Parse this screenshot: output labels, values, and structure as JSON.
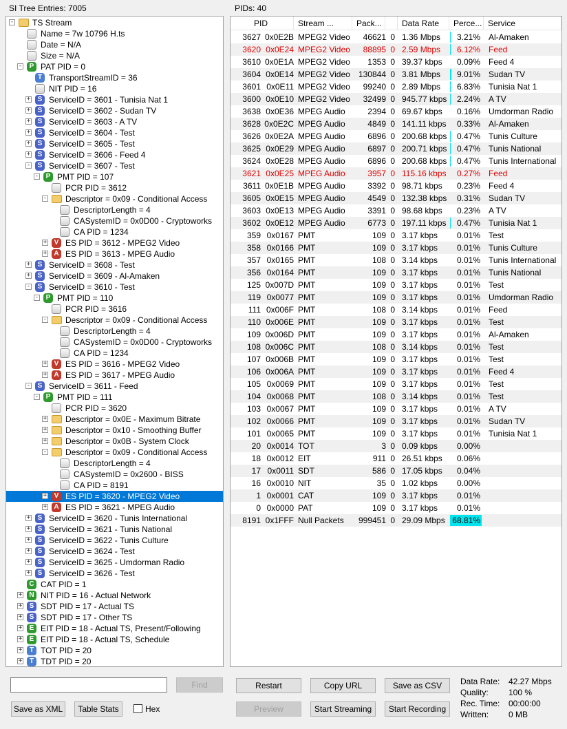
{
  "left_label": "SI Tree Entries: 7005",
  "right_label": "PIDs: 40",
  "tree": [
    {
      "d": 0,
      "e": "-",
      "i": "folder",
      "t": "TS Stream"
    },
    {
      "d": 1,
      "e": "",
      "i": "doc",
      "t": "Name = 7w 10796 H.ts"
    },
    {
      "d": 1,
      "e": "",
      "i": "doc",
      "t": "Date = N/A"
    },
    {
      "d": 1,
      "e": "",
      "i": "doc",
      "t": "Size = N/A"
    },
    {
      "d": 1,
      "e": "-",
      "i": "P",
      "t": "PAT PID = 0"
    },
    {
      "d": 2,
      "e": "",
      "i": "T",
      "t": "TransportStreamID = 36"
    },
    {
      "d": 2,
      "e": "",
      "i": "doc",
      "t": "NIT PID = 16"
    },
    {
      "d": 2,
      "e": "+",
      "i": "S",
      "t": "ServiceID = 3601 - Tunisia Nat 1"
    },
    {
      "d": 2,
      "e": "+",
      "i": "S",
      "t": "ServiceID = 3602 - Sudan TV"
    },
    {
      "d": 2,
      "e": "+",
      "i": "S",
      "t": "ServiceID = 3603 - A TV"
    },
    {
      "d": 2,
      "e": "+",
      "i": "S",
      "t": "ServiceID = 3604 - Test"
    },
    {
      "d": 2,
      "e": "+",
      "i": "S",
      "t": "ServiceID = 3605 - Test"
    },
    {
      "d": 2,
      "e": "+",
      "i": "S",
      "t": "ServiceID = 3606 - Feed 4"
    },
    {
      "d": 2,
      "e": "-",
      "i": "S",
      "t": "ServiceID = 3607 - Test"
    },
    {
      "d": 3,
      "e": "-",
      "i": "P",
      "t": "PMT PID = 107"
    },
    {
      "d": 4,
      "e": "",
      "i": "doc",
      "t": "PCR PID = 3612"
    },
    {
      "d": 4,
      "e": "-",
      "i": "folder",
      "t": "Descriptor = 0x09 - Conditional Access"
    },
    {
      "d": 5,
      "e": "",
      "i": "doc",
      "t": "DescriptorLength = 4"
    },
    {
      "d": 5,
      "e": "",
      "i": "doc",
      "t": "CASystemID = 0x0D00 - Cryptoworks"
    },
    {
      "d": 5,
      "e": "",
      "i": "doc",
      "t": "CA PID = 1234"
    },
    {
      "d": 4,
      "e": "+",
      "i": "V",
      "t": "ES PID = 3612 - MPEG2 Video"
    },
    {
      "d": 4,
      "e": "+",
      "i": "A",
      "t": "ES PID = 3613 - MPEG Audio"
    },
    {
      "d": 2,
      "e": "+",
      "i": "S",
      "t": "ServiceID = 3608 - Test"
    },
    {
      "d": 2,
      "e": "+",
      "i": "S",
      "t": "ServiceID = 3609 - Al-Amaken"
    },
    {
      "d": 2,
      "e": "-",
      "i": "S",
      "t": "ServiceID = 3610 - Test"
    },
    {
      "d": 3,
      "e": "-",
      "i": "P",
      "t": "PMT PID = 110"
    },
    {
      "d": 4,
      "e": "",
      "i": "doc",
      "t": "PCR PID = 3616"
    },
    {
      "d": 4,
      "e": "-",
      "i": "folder",
      "t": "Descriptor = 0x09 - Conditional Access"
    },
    {
      "d": 5,
      "e": "",
      "i": "doc",
      "t": "DescriptorLength = 4"
    },
    {
      "d": 5,
      "e": "",
      "i": "doc",
      "t": "CASystemID = 0x0D00 - Cryptoworks"
    },
    {
      "d": 5,
      "e": "",
      "i": "doc",
      "t": "CA PID = 1234"
    },
    {
      "d": 4,
      "e": "+",
      "i": "V",
      "t": "ES PID = 3616 - MPEG2 Video"
    },
    {
      "d": 4,
      "e": "+",
      "i": "A",
      "t": "ES PID = 3617 - MPEG Audio"
    },
    {
      "d": 2,
      "e": "-",
      "i": "S",
      "t": "ServiceID = 3611 - Feed"
    },
    {
      "d": 3,
      "e": "-",
      "i": "P",
      "t": "PMT PID = 111"
    },
    {
      "d": 4,
      "e": "",
      "i": "doc",
      "t": "PCR PID = 3620"
    },
    {
      "d": 4,
      "e": "+",
      "i": "folder",
      "t": "Descriptor = 0x0E - Maximum Bitrate"
    },
    {
      "d": 4,
      "e": "+",
      "i": "folder",
      "t": "Descriptor = 0x10 - Smoothing Buffer"
    },
    {
      "d": 4,
      "e": "+",
      "i": "folder",
      "t": "Descriptor = 0x0B - System Clock"
    },
    {
      "d": 4,
      "e": "-",
      "i": "folder",
      "t": "Descriptor = 0x09 - Conditional Access"
    },
    {
      "d": 5,
      "e": "",
      "i": "doc",
      "t": "DescriptorLength = 4"
    },
    {
      "d": 5,
      "e": "",
      "i": "doc",
      "t": "CASystemID = 0x2600 - BISS"
    },
    {
      "d": 5,
      "e": "",
      "i": "doc",
      "t": "CA PID = 8191"
    },
    {
      "d": 4,
      "e": "+",
      "i": "V",
      "t": "ES PID = 3620 - MPEG2 Video",
      "sel": true
    },
    {
      "d": 4,
      "e": "+",
      "i": "A",
      "t": "ES PID = 3621 - MPEG Audio"
    },
    {
      "d": 2,
      "e": "+",
      "i": "S",
      "t": "ServiceID = 3620 - Tunis International"
    },
    {
      "d": 2,
      "e": "+",
      "i": "S",
      "t": "ServiceID = 3621 - Tunis National"
    },
    {
      "d": 2,
      "e": "+",
      "i": "S",
      "t": "ServiceID = 3622 - Tunis Culture"
    },
    {
      "d": 2,
      "e": "+",
      "i": "S",
      "t": "ServiceID = 3624 - Test"
    },
    {
      "d": 2,
      "e": "+",
      "i": "S",
      "t": "ServiceID = 3625 - Umdorman Radio"
    },
    {
      "d": 2,
      "e": "+",
      "i": "S",
      "t": "ServiceID = 3626 - Test"
    },
    {
      "d": 1,
      "e": "",
      "i": "C",
      "t": "CAT PID = 1"
    },
    {
      "d": 1,
      "e": "+",
      "i": "N",
      "t": "NIT PID = 16 - Actual Network"
    },
    {
      "d": 1,
      "e": "+",
      "i": "S",
      "t": "SDT PID = 17 - Actual TS"
    },
    {
      "d": 1,
      "e": "+",
      "i": "S",
      "t": "SDT PID = 17 - Other TS"
    },
    {
      "d": 1,
      "e": "+",
      "i": "E",
      "t": "EIT PID = 18 - Actual TS, Present/Following"
    },
    {
      "d": 1,
      "e": "+",
      "i": "E",
      "t": "EIT PID = 18 - Actual TS, Schedule"
    },
    {
      "d": 1,
      "e": "+",
      "i": "T",
      "t": "TOT PID = 20"
    },
    {
      "d": 1,
      "e": "+",
      "i": "T",
      "t": "TDT PID = 20"
    }
  ],
  "columns": [
    "PID",
    "Stream ...",
    "Pack...",
    "",
    "Data Rate",
    "Perce...",
    "Service"
  ],
  "rows": [
    {
      "pid": "3627",
      "hex": "0x0E2B",
      "type": "MPEG2 Video",
      "pk": "46621",
      "cc": "0",
      "rate": "1.36 Mbps",
      "pct": "3.21%",
      "pv": 3.21,
      "svc": "Al-Amaken"
    },
    {
      "pid": "3620",
      "hex": "0x0E24",
      "type": "MPEG2 Video",
      "pk": "88895",
      "cc": "0",
      "rate": "2.59 Mbps",
      "pct": "6.12%",
      "pv": 6.12,
      "svc": "Feed",
      "red": true
    },
    {
      "pid": "3610",
      "hex": "0x0E1A",
      "type": "MPEG2 Video",
      "pk": "1353",
      "cc": "0",
      "rate": "39.37 kbps",
      "pct": "0.09%",
      "pv": 0.09,
      "svc": "Feed 4"
    },
    {
      "pid": "3604",
      "hex": "0x0E14",
      "type": "MPEG2 Video",
      "pk": "130844",
      "cc": "0",
      "rate": "3.81 Mbps",
      "pct": "9.01%",
      "pv": 9.01,
      "svc": "Sudan TV"
    },
    {
      "pid": "3601",
      "hex": "0x0E11",
      "type": "MPEG2 Video",
      "pk": "99240",
      "cc": "0",
      "rate": "2.89 Mbps",
      "pct": "6.83%",
      "pv": 6.83,
      "svc": "Tunisia Nat 1"
    },
    {
      "pid": "3600",
      "hex": "0x0E10",
      "type": "MPEG2 Video",
      "pk": "32499",
      "cc": "0",
      "rate": "945.77 kbps",
      "pct": "2.24%",
      "pv": 2.24,
      "svc": "A TV"
    },
    {
      "pid": "3638",
      "hex": "0x0E36",
      "type": "MPEG Audio",
      "pk": "2394",
      "cc": "0",
      "rate": "69.67 kbps",
      "pct": "0.16%",
      "pv": 0.16,
      "svc": "Umdorman Radio"
    },
    {
      "pid": "3628",
      "hex": "0x0E2C",
      "type": "MPEG Audio",
      "pk": "4849",
      "cc": "0",
      "rate": "141.11 kbps",
      "pct": "0.33%",
      "pv": 0.33,
      "svc": "Al-Amaken"
    },
    {
      "pid": "3626",
      "hex": "0x0E2A",
      "type": "MPEG Audio",
      "pk": "6896",
      "cc": "0",
      "rate": "200.68 kbps",
      "pct": "0.47%",
      "pv": 0.47,
      "svc": "Tunis Culture"
    },
    {
      "pid": "3625",
      "hex": "0x0E29",
      "type": "MPEG Audio",
      "pk": "6897",
      "cc": "0",
      "rate": "200.71 kbps",
      "pct": "0.47%",
      "pv": 0.47,
      "svc": "Tunis National"
    },
    {
      "pid": "3624",
      "hex": "0x0E28",
      "type": "MPEG Audio",
      "pk": "6896",
      "cc": "0",
      "rate": "200.68 kbps",
      "pct": "0.47%",
      "pv": 0.47,
      "svc": "Tunis International"
    },
    {
      "pid": "3621",
      "hex": "0x0E25",
      "type": "MPEG Audio",
      "pk": "3957",
      "cc": "0",
      "rate": "115.16 kbps",
      "pct": "0.27%",
      "pv": 0.27,
      "svc": "Feed",
      "red": true
    },
    {
      "pid": "3611",
      "hex": "0x0E1B",
      "type": "MPEG Audio",
      "pk": "3392",
      "cc": "0",
      "rate": "98.71 kbps",
      "pct": "0.23%",
      "pv": 0.23,
      "svc": "Feed 4"
    },
    {
      "pid": "3605",
      "hex": "0x0E15",
      "type": "MPEG Audio",
      "pk": "4549",
      "cc": "0",
      "rate": "132.38 kbps",
      "pct": "0.31%",
      "pv": 0.31,
      "svc": "Sudan TV"
    },
    {
      "pid": "3603",
      "hex": "0x0E13",
      "type": "MPEG Audio",
      "pk": "3391",
      "cc": "0",
      "rate": "98.68 kbps",
      "pct": "0.23%",
      "pv": 0.23,
      "svc": "A TV"
    },
    {
      "pid": "3602",
      "hex": "0x0E12",
      "type": "MPEG Audio",
      "pk": "6773",
      "cc": "0",
      "rate": "197.11 kbps",
      "pct": "0.47%",
      "pv": 0.47,
      "svc": "Tunisia Nat 1"
    },
    {
      "pid": "359",
      "hex": "0x0167",
      "type": "PMT",
      "pk": "109",
      "cc": "0",
      "rate": "3.17 kbps",
      "pct": "0.01%",
      "pv": 0.01,
      "svc": "Test"
    },
    {
      "pid": "358",
      "hex": "0x0166",
      "type": "PMT",
      "pk": "109",
      "cc": "0",
      "rate": "3.17 kbps",
      "pct": "0.01%",
      "pv": 0.01,
      "svc": "Tunis Culture"
    },
    {
      "pid": "357",
      "hex": "0x0165",
      "type": "PMT",
      "pk": "108",
      "cc": "0",
      "rate": "3.14 kbps",
      "pct": "0.01%",
      "pv": 0.01,
      "svc": "Tunis International"
    },
    {
      "pid": "356",
      "hex": "0x0164",
      "type": "PMT",
      "pk": "109",
      "cc": "0",
      "rate": "3.17 kbps",
      "pct": "0.01%",
      "pv": 0.01,
      "svc": "Tunis National"
    },
    {
      "pid": "125",
      "hex": "0x007D",
      "type": "PMT",
      "pk": "109",
      "cc": "0",
      "rate": "3.17 kbps",
      "pct": "0.01%",
      "pv": 0.01,
      "svc": "Test"
    },
    {
      "pid": "119",
      "hex": "0x0077",
      "type": "PMT",
      "pk": "109",
      "cc": "0",
      "rate": "3.17 kbps",
      "pct": "0.01%",
      "pv": 0.01,
      "svc": "Umdorman Radio"
    },
    {
      "pid": "111",
      "hex": "0x006F",
      "type": "PMT",
      "pk": "108",
      "cc": "0",
      "rate": "3.14 kbps",
      "pct": "0.01%",
      "pv": 0.01,
      "svc": "Feed"
    },
    {
      "pid": "110",
      "hex": "0x006E",
      "type": "PMT",
      "pk": "109",
      "cc": "0",
      "rate": "3.17 kbps",
      "pct": "0.01%",
      "pv": 0.01,
      "svc": "Test"
    },
    {
      "pid": "109",
      "hex": "0x006D",
      "type": "PMT",
      "pk": "109",
      "cc": "0",
      "rate": "3.17 kbps",
      "pct": "0.01%",
      "pv": 0.01,
      "svc": "Al-Amaken"
    },
    {
      "pid": "108",
      "hex": "0x006C",
      "type": "PMT",
      "pk": "108",
      "cc": "0",
      "rate": "3.14 kbps",
      "pct": "0.01%",
      "pv": 0.01,
      "svc": "Test"
    },
    {
      "pid": "107",
      "hex": "0x006B",
      "type": "PMT",
      "pk": "109",
      "cc": "0",
      "rate": "3.17 kbps",
      "pct": "0.01%",
      "pv": 0.01,
      "svc": "Test"
    },
    {
      "pid": "106",
      "hex": "0x006A",
      "type": "PMT",
      "pk": "109",
      "cc": "0",
      "rate": "3.17 kbps",
      "pct": "0.01%",
      "pv": 0.01,
      "svc": "Feed 4"
    },
    {
      "pid": "105",
      "hex": "0x0069",
      "type": "PMT",
      "pk": "109",
      "cc": "0",
      "rate": "3.17 kbps",
      "pct": "0.01%",
      "pv": 0.01,
      "svc": "Test"
    },
    {
      "pid": "104",
      "hex": "0x0068",
      "type": "PMT",
      "pk": "108",
      "cc": "0",
      "rate": "3.14 kbps",
      "pct": "0.01%",
      "pv": 0.01,
      "svc": "Test"
    },
    {
      "pid": "103",
      "hex": "0x0067",
      "type": "PMT",
      "pk": "109",
      "cc": "0",
      "rate": "3.17 kbps",
      "pct": "0.01%",
      "pv": 0.01,
      "svc": "A TV"
    },
    {
      "pid": "102",
      "hex": "0x0066",
      "type": "PMT",
      "pk": "109",
      "cc": "0",
      "rate": "3.17 kbps",
      "pct": "0.01%",
      "pv": 0.01,
      "svc": "Sudan TV"
    },
    {
      "pid": "101",
      "hex": "0x0065",
      "type": "PMT",
      "pk": "109",
      "cc": "0",
      "rate": "3.17 kbps",
      "pct": "0.01%",
      "pv": 0.01,
      "svc": "Tunisia Nat 1"
    },
    {
      "pid": "20",
      "hex": "0x0014",
      "type": "TOT",
      "pk": "3",
      "cc": "0",
      "rate": "0.09 kbps",
      "pct": "0.00%",
      "pv": 0,
      "svc": ""
    },
    {
      "pid": "18",
      "hex": "0x0012",
      "type": "EIT",
      "pk": "911",
      "cc": "0",
      "rate": "26.51 kbps",
      "pct": "0.06%",
      "pv": 0.06,
      "svc": ""
    },
    {
      "pid": "17",
      "hex": "0x0011",
      "type": "SDT",
      "pk": "586",
      "cc": "0",
      "rate": "17.05 kbps",
      "pct": "0.04%",
      "pv": 0.04,
      "svc": ""
    },
    {
      "pid": "16",
      "hex": "0x0010",
      "type": "NIT",
      "pk": "35",
      "cc": "0",
      "rate": "1.02 kbps",
      "pct": "0.00%",
      "pv": 0,
      "svc": ""
    },
    {
      "pid": "1",
      "hex": "0x0001",
      "type": "CAT",
      "pk": "109",
      "cc": "0",
      "rate": "3.17 kbps",
      "pct": "0.01%",
      "pv": 0.01,
      "svc": ""
    },
    {
      "pid": "0",
      "hex": "0x0000",
      "type": "PAT",
      "pk": "109",
      "cc": "0",
      "rate": "3.17 kbps",
      "pct": "0.01%",
      "pv": 0.01,
      "svc": ""
    },
    {
      "pid": "8191",
      "hex": "0x1FFF",
      "type": "Null Packets",
      "pk": "999451",
      "cc": "0",
      "rate": "29.09 Mbps",
      "pct": "68.81%",
      "pv": 68.81,
      "svc": ""
    }
  ],
  "controls": {
    "search_value": "",
    "find": "Find",
    "save_xml": "Save as XML",
    "table_stats": "Table Stats",
    "hex": "Hex",
    "restart": "Restart",
    "copy_url": "Copy URL",
    "save_csv": "Save as CSV",
    "preview": "Preview",
    "start_streaming": "Start Streaming",
    "start_recording": "Start Recording"
  },
  "stats": {
    "data_rate_label": "Data Rate:",
    "data_rate": "42.27 Mbps",
    "quality_label": "Quality:",
    "quality": "100 %",
    "rec_time_label": "Rec. Time:",
    "rec_time": "00:00:00",
    "written_label": "Written:",
    "written": "0 MB"
  },
  "colors": {
    "selection": "#0078d7",
    "highlight_row": "#e00000",
    "percent_bar": "#00e5ee"
  }
}
